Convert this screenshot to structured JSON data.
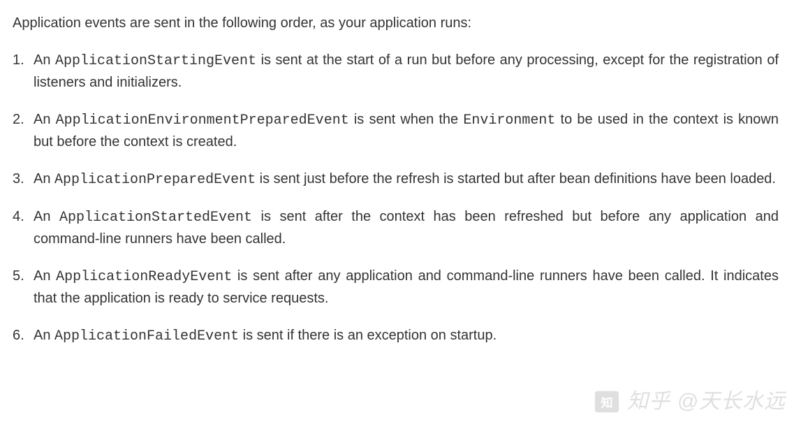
{
  "intro": "Application events are sent in the following order, as your application runs:",
  "items": [
    {
      "prefix": "An ",
      "code1": "ApplicationStartingEvent",
      "mid1": " is sent at the start of a run but before any processing, except for the registration of listeners and initializers."
    },
    {
      "prefix": "An ",
      "code1": "ApplicationEnvironmentPreparedEvent",
      "mid1": " is sent when the ",
      "code2": "Environment",
      "mid2": " to be used in the context is known but before the context is created."
    },
    {
      "prefix": "An ",
      "code1": "ApplicationPreparedEvent",
      "mid1": " is sent just before the refresh is started but after bean definitions have been loaded."
    },
    {
      "prefix": "An ",
      "code1": "ApplicationStartedEvent",
      "mid1": " is sent after the context has been refreshed but before any application and command-line runners have been called."
    },
    {
      "prefix": "An ",
      "code1": "ApplicationReadyEvent",
      "mid1": " is sent after any application and command-line runners have been called. It indicates that the application is ready to service requests."
    },
    {
      "prefix": "An ",
      "code1": "ApplicationFailedEvent",
      "mid1": " is sent if there is an exception on startup."
    }
  ],
  "watermark": {
    "label": "知乎 @天长水远"
  }
}
